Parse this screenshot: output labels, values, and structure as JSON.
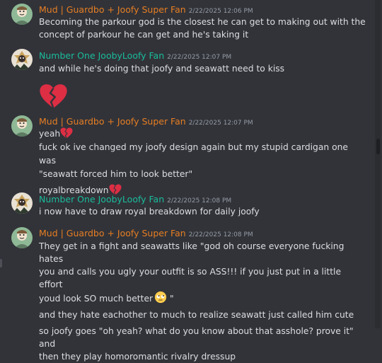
{
  "colors": {
    "background": "#323339",
    "mud_name": "#e67e22",
    "number_one_name": "#1abc9c",
    "timestamp": "#949ba4",
    "text": "#dbdee1"
  },
  "messages": [
    {
      "author": "Mud | Guardbo + Joofy Super Fan",
      "timestamp": "2/22/2025 12:06 PM",
      "lines": [
        "Becoming the parkour god is the closest he can get to making out with the",
        "concept of parkour he can get and he's taking it"
      ]
    },
    {
      "author": "Number One JoobyLoofy Fan",
      "timestamp": "2/22/2025 12:07 PM",
      "lines": [
        "and while he's doing that joofy and seawatt need to kiss"
      ],
      "emoji": "broken-heart"
    },
    {
      "author": "Mud | Guardbo + Joofy Super Fan",
      "timestamp": "2/22/2025 12:07 PM",
      "lines": [
        "yeah",
        "fuck ok ive changed my joofy design again but my stupid cardigan one was",
        "\"seawatt forced him to look better\"",
        "royalbreakdown"
      ]
    },
    {
      "author": "Number One JoobyLoofy Fan",
      "timestamp": "2/22/2025 12:08 PM",
      "lines": [
        "i now have to draw royal breakdown for daily joofy"
      ]
    },
    {
      "author": "Mud | Guardbo + Joofy Super Fan",
      "timestamp": "2/22/2025 12:08 PM",
      "lines": [
        "They get in a fight and seawatts like \"god oh course everyone fucking hates",
        "you and calls you ugly your outfit is so ASS!!! if you just put in a little effort",
        "youd look SO much better",
        " \"",
        "and they hate eachother to much to realize seawatt just called him cute",
        "so joofy goes \"oh yeah? what do you know about that asshole? prove it\" and",
        "then they play homoromantic rivalry dressup"
      ]
    }
  ]
}
